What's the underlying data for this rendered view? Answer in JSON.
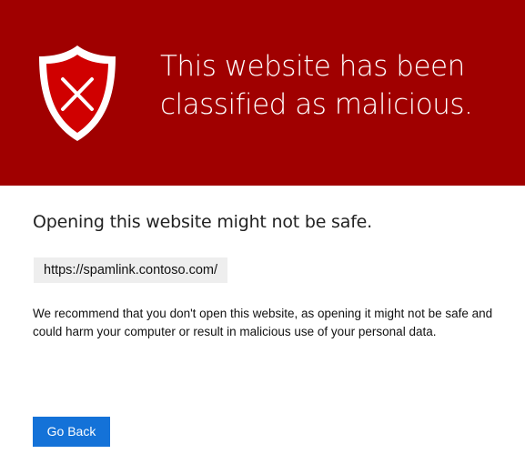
{
  "banner": {
    "title": "This website has been classified as malicious.",
    "icon": "shield-x-icon",
    "background_color": "#a00000"
  },
  "content": {
    "title": "Opening this website might not be safe.",
    "url": "https://spamlink.contoso.com/",
    "recommendation": "We recommend that you don't open this website, as opening it might not be safe and could harm your computer or result in malicious use of your personal data."
  },
  "actions": {
    "go_back_label": "Go Back",
    "button_color": "#1472d8"
  }
}
